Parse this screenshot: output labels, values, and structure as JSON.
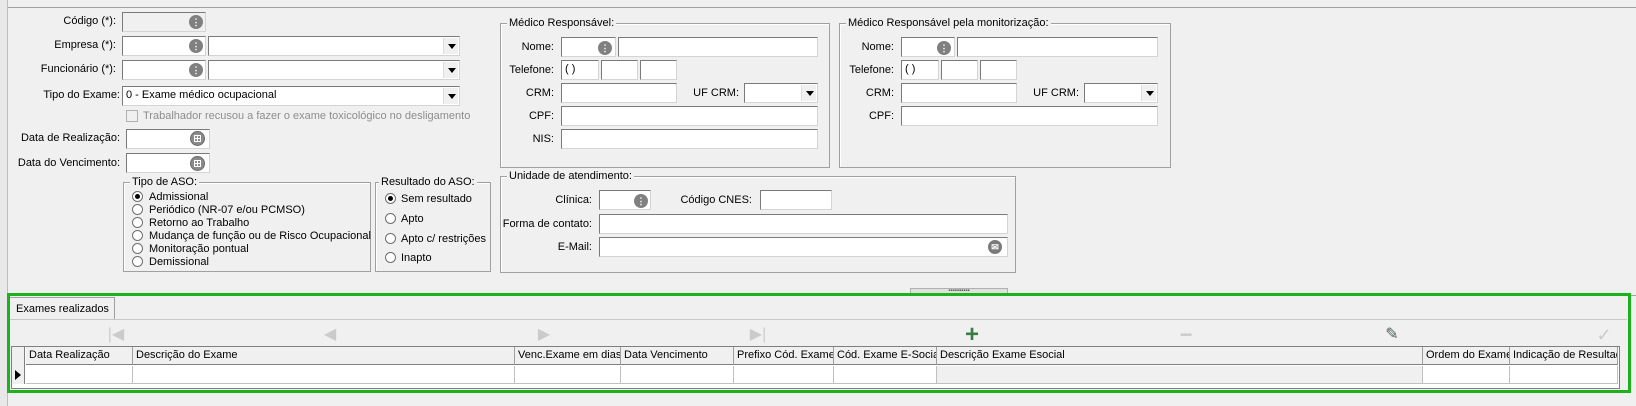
{
  "form": {
    "codigo_label": "Código (*):",
    "empresa_label": "Empresa (*):",
    "funcionario_label": "Funcionário (*):",
    "tipo_exame_label": "Tipo do Exame:",
    "tipo_exame_value": "0 - Exame médico ocupacional",
    "recusou_label": "Trabalhador recusou a fazer o exame toxicológico no desligamento",
    "data_realizacao_label": "Data de Realização:",
    "data_vencimento_label": "Data do Vencimento:"
  },
  "tipo_aso": {
    "title": "Tipo de ASO:",
    "options": [
      "Admissional",
      "Periódico (NR-07 e/ou PCMSO)",
      "Retorno ao Trabalho",
      "Mudança de função ou de Risco Ocupacional",
      "Monitoração pontual",
      "Demissional"
    ],
    "selected": 0
  },
  "resultado_aso": {
    "title": "Resultado do ASO:",
    "options": [
      "Sem resultado",
      "Apto",
      "Apto c/ restrições",
      "Inapto"
    ],
    "selected": 0
  },
  "medico_responsavel": {
    "title": "Médico Responsável:",
    "nome_label": "Nome:",
    "telefone_label": "Telefone:",
    "telefone_mask": "(  )",
    "crm_label": "CRM:",
    "uf_crm_label": "UF CRM:",
    "cpf_label": "CPF:",
    "nis_label": "NIS:"
  },
  "medico_monitorizacao": {
    "title": "Médico Responsável pela monitorização:",
    "nome_label": "Nome:",
    "telefone_label": "Telefone:",
    "telefone_mask": "(  )",
    "crm_label": "CRM:",
    "uf_crm_label": "UF CRM:",
    "cpf_label": "CPF:"
  },
  "unidade": {
    "title": "Unidade de atendimento:",
    "clinica_label": "Clínica:",
    "codigo_cnes_label": "Código CNES:",
    "forma_contato_label": "Forma de contato:",
    "email_label": "E-Mail:"
  },
  "exames": {
    "tab_label": "Exames realizados",
    "navigator": [
      "first-icon",
      "prior-icon",
      "next-icon",
      "last-icon",
      "plus-icon",
      "minus-icon",
      "edit-icon",
      "check-icon"
    ],
    "columns": [
      "Data Realização",
      "Descrição do Exame",
      "Venc.Exame em dias",
      "Data Vencimento",
      "Prefixo Cód. Exame",
      "Cód. Exame E-Social",
      "Descrição Exame Esocial",
      "Ordem do Exame",
      "Indicação de Resultados"
    ]
  },
  "colors": {
    "highlight_border": "#1bb21b",
    "nav_add": "#3a7d44",
    "nav_edit": "#4b5e52",
    "nav_disabled": "#cbcbcb"
  }
}
